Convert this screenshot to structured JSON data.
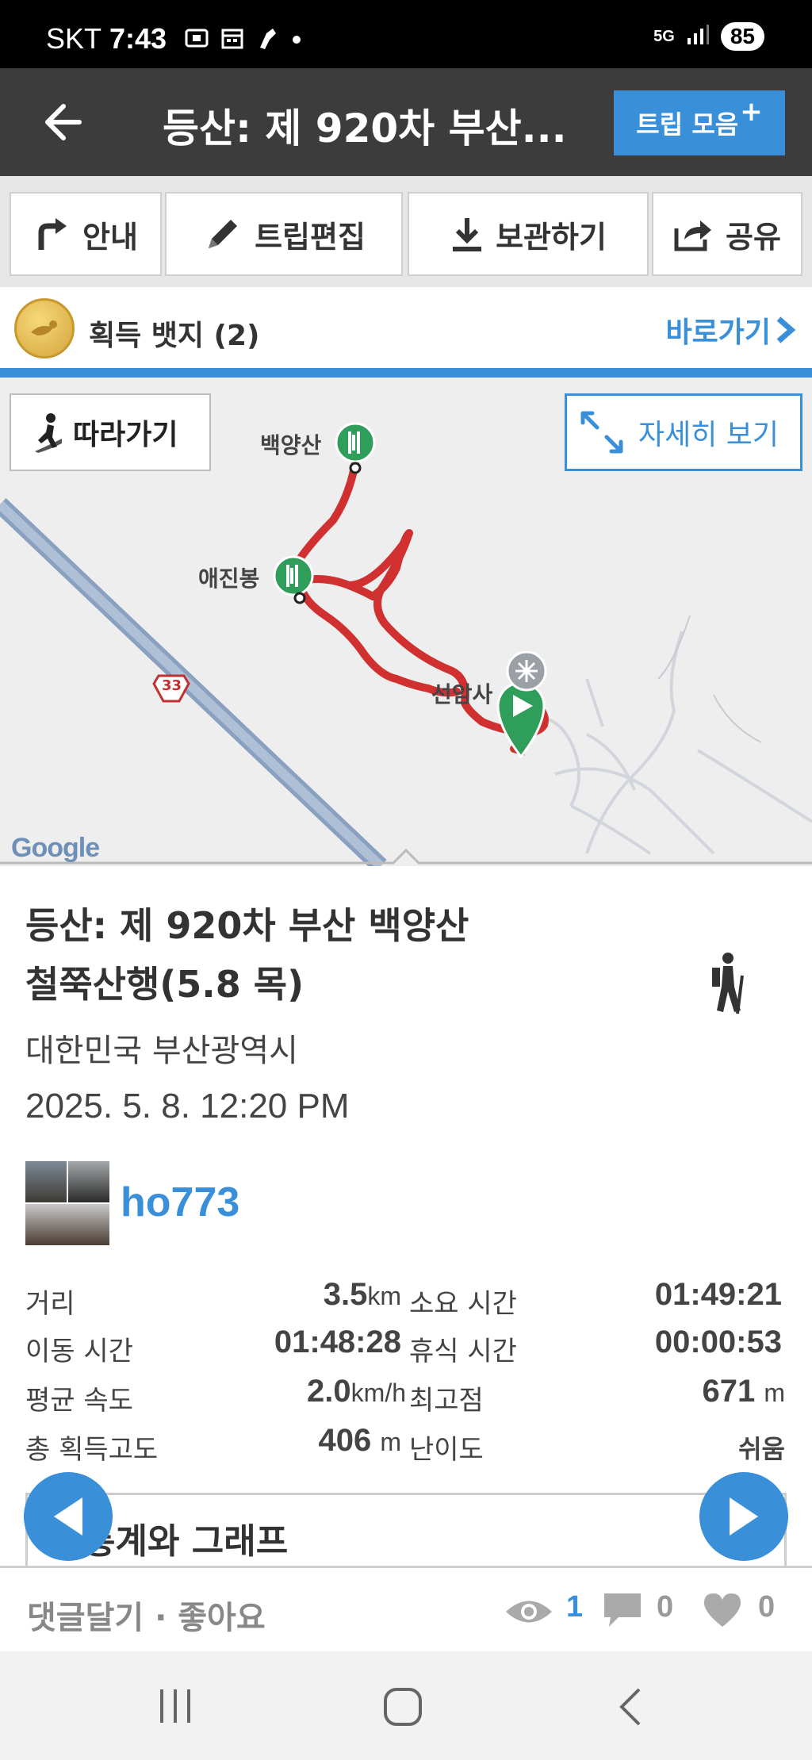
{
  "status_bar": {
    "carrier": "SKT",
    "time": "7:43",
    "network": "5G",
    "battery": "85"
  },
  "app_bar": {
    "title": "등산: 제 920차 부산...",
    "trip_button": "트립 모음",
    "trip_plus": "+"
  },
  "actions": [
    {
      "label": "안내",
      "icon": "turn-right-icon"
    },
    {
      "label": "트립편집",
      "icon": "pencil-icon"
    },
    {
      "label": "보관하기",
      "icon": "download-icon"
    },
    {
      "label": "공유",
      "icon": "share-icon"
    }
  ],
  "badges": {
    "label": "획득 뱃지 (2)",
    "goto": "바로가기"
  },
  "map": {
    "follow_button": "따라가기",
    "detail_button": "자세히 보기",
    "labels": {
      "peak1": "백양산",
      "peak2": "애진봉",
      "temple": "선암사",
      "road": "33"
    },
    "google": "Google"
  },
  "trip": {
    "title_line1": "등산: 제 920차 부산 백양산",
    "title_line2": "철쭉산행(5.8 목)",
    "location": "대한민국 부산광역시",
    "date": "2025. 5. 8. 12:20 PM",
    "username": "ho773"
  },
  "stats": {
    "distance": {
      "label": "거리",
      "value": "3.5",
      "unit": "km"
    },
    "duration": {
      "label": "소요 시간",
      "value": "01:49:21"
    },
    "moving": {
      "label": "이동 시간",
      "value": "01:48:28"
    },
    "rest": {
      "label": "휴식 시간",
      "value": "00:00:53"
    },
    "avg_speed": {
      "label": "평균 속도",
      "value": "2.0",
      "unit": "km/h"
    },
    "max_alt": {
      "label": "최고점",
      "value": "671",
      "unit": "m"
    },
    "gain": {
      "label": "총 획득고도",
      "value": "406",
      "unit": "m"
    },
    "difficulty": {
      "label": "난이도",
      "value": "쉬움"
    }
  },
  "section_title": "통계와 그래프",
  "comment_bar": {
    "text": "댓글달기 · 좋아요",
    "views": "1",
    "comments": "0",
    "likes": "0"
  },
  "colors": {
    "accent": "#3a8fd9",
    "track": "#d03030",
    "appbar": "#3c3c3c",
    "peak_marker": "#2e9e5a"
  }
}
